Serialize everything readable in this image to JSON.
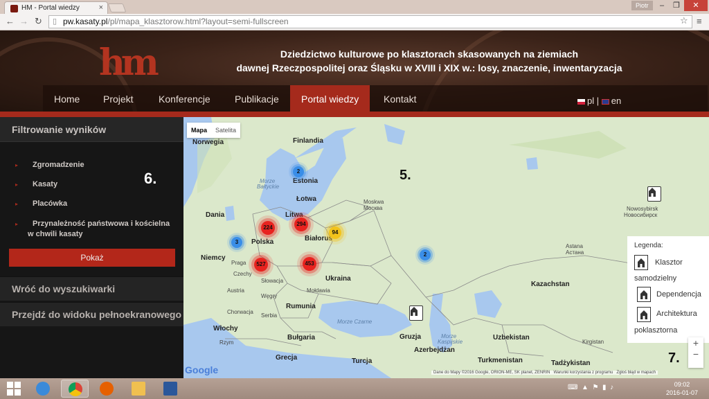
{
  "browser": {
    "tab_title": "HM - Portal wiedzy",
    "user": "Piotr",
    "url_host": "pw.kasaty.pl",
    "url_path": "/pl/mapa_klasztorow.html?layout=semi-fullscreen"
  },
  "site": {
    "logo": "hm",
    "headline_1": "Dziedzictwo kulturowe po klasztorach skasowanych na ziemiach",
    "headline_2": "dawnej Rzeczpospolitej oraz Śląsku w XVIII i XIX w.: losy, znaczenie, inwentaryzacja",
    "nav": [
      "Home",
      "Projekt",
      "Konferencje",
      "Publikacje",
      "Portal wiedzy",
      "Kontakt"
    ],
    "lang_pl": "pl",
    "lang_sep": " | ",
    "lang_en": "en"
  },
  "sidebar": {
    "filter_title": "Filtrowanie wyników",
    "filters": [
      "Zgromadzenie",
      "Kasaty",
      "Placówka",
      "Przynależność państwowa i kościelna"
    ],
    "filter_4_line2": "w chwili kasaty",
    "annotation": "6.",
    "show_button": "Pokaż",
    "back_link": "Wróć do wyszukiwarki",
    "fullscreen_link": "Przejdź do widoku pełnoekranowego"
  },
  "map": {
    "type_map": "Mapa",
    "type_sat": "Satelita",
    "annotation_5": "5.",
    "annotation_7": "7.",
    "labels": {
      "norway": "Norwegia",
      "finland": "Finlandia",
      "estonia": "Estonia",
      "baltic_1": "Morze",
      "baltic_2": "Bałtyckie",
      "latvia": "Łotwa",
      "denmark": "Dania",
      "lithuania": "Litwa",
      "moscow_1": "Moskwa",
      "moscow_2": "Москва",
      "poland": "Polska",
      "belarus": "Białoruś",
      "germany": "Niemcy",
      "prague": "Praga",
      "czech": "Czechy",
      "slovakia": "Słowacja",
      "austria": "Austria",
      "hungary": "Węgry",
      "ukraine": "Ukraina",
      "moldova": "Mołdawia",
      "croatia": "Chorwacja",
      "romania": "Rumunia",
      "serbia": "Serbia",
      "italy": "Włochy",
      "rome": "Rzym",
      "bulgaria": "Bułgaria",
      "greece": "Grecja",
      "turkey": "Turcja",
      "black_sea": "Morze Czarne",
      "georgia": "Gruzja",
      "caspian_1": "Morze",
      "caspian_2": "Kaspijskie",
      "azerbaijan": "Azerbejdżan",
      "kazakhstan": "Kazachstan",
      "uzbekistan": "Uzbekistan",
      "turkmenistan": "Turkmenistan",
      "kyrgyzstan": "Kirgistan",
      "tajikistan": "Tadżykistan",
      "astana_1": "Astana",
      "astana_2": "Астана",
      "novosibirsk_1": "Nowosybirsk",
      "novosibirsk_2": "Новосибирск"
    },
    "clusters": {
      "c224": "224",
      "c294": "294",
      "c94": "94",
      "c3": "3",
      "c527": "527",
      "c453": "453",
      "c2a": "2",
      "c2b": "2"
    },
    "legend_title": "Legenda:",
    "legend": [
      "Klasztor",
      "samodzielny",
      "Dependencja",
      "Architektura",
      "poklasztorna"
    ],
    "zoom_in": "+",
    "zoom_out": "−",
    "google": "Google",
    "attribution": "Dane do Mapy ©2016 Google, ORION-ME, SK planet, ZENRIN",
    "terms": "Warunki korzystania z programu",
    "report": "Zgłoś błąd w mapach"
  },
  "taskbar": {
    "time": "09:02",
    "date": "2016-01-07"
  }
}
